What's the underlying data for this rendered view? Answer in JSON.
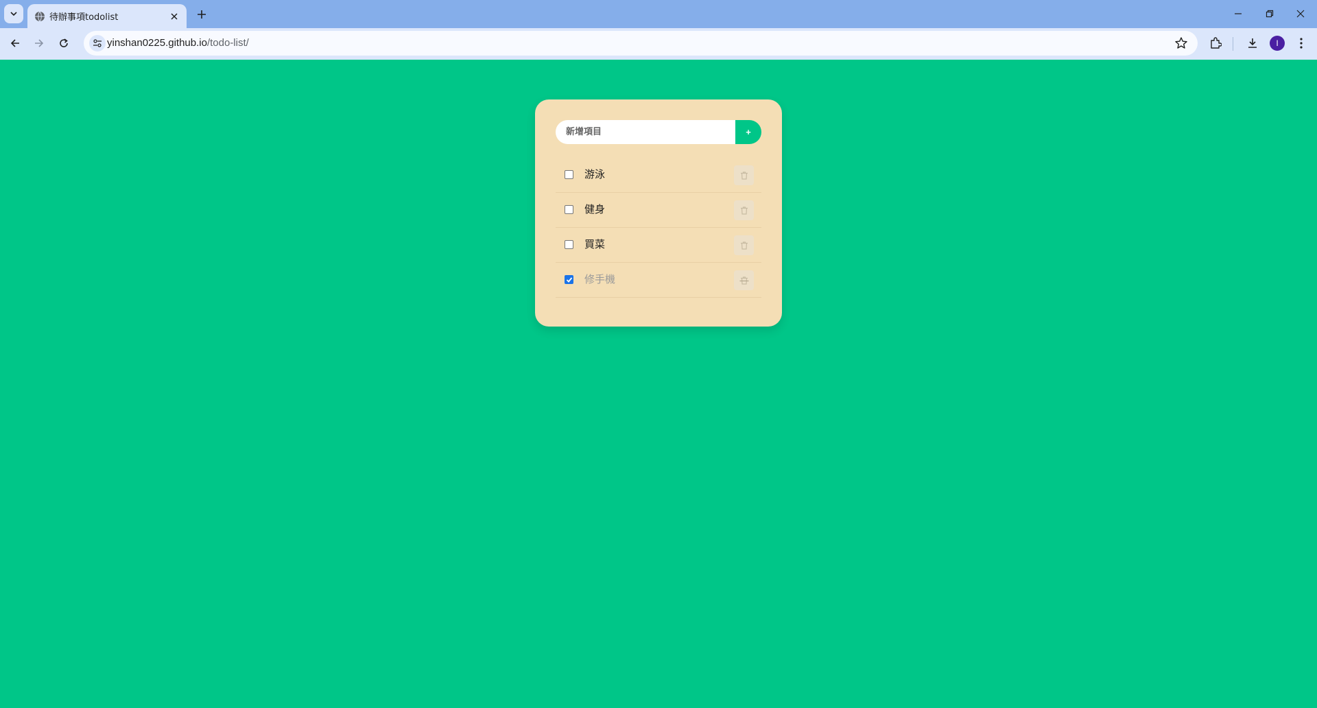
{
  "browser": {
    "tab_title": "待辦事項todolist",
    "url_host": "yinshan0225.github.io",
    "url_path": "/todo-list/",
    "profile_initial": "I"
  },
  "todo": {
    "input_placeholder": "新增項目",
    "add_label": "+",
    "items": [
      {
        "text": "游泳",
        "done": false
      },
      {
        "text": "健身",
        "done": false
      },
      {
        "text": "買菜",
        "done": false
      },
      {
        "text": "修手機",
        "done": true
      }
    ]
  },
  "colors": {
    "page_background": "#00c688",
    "card_background": "#f4deb5",
    "accent": "#00c688",
    "checkbox_checked": "#1a73e8"
  }
}
